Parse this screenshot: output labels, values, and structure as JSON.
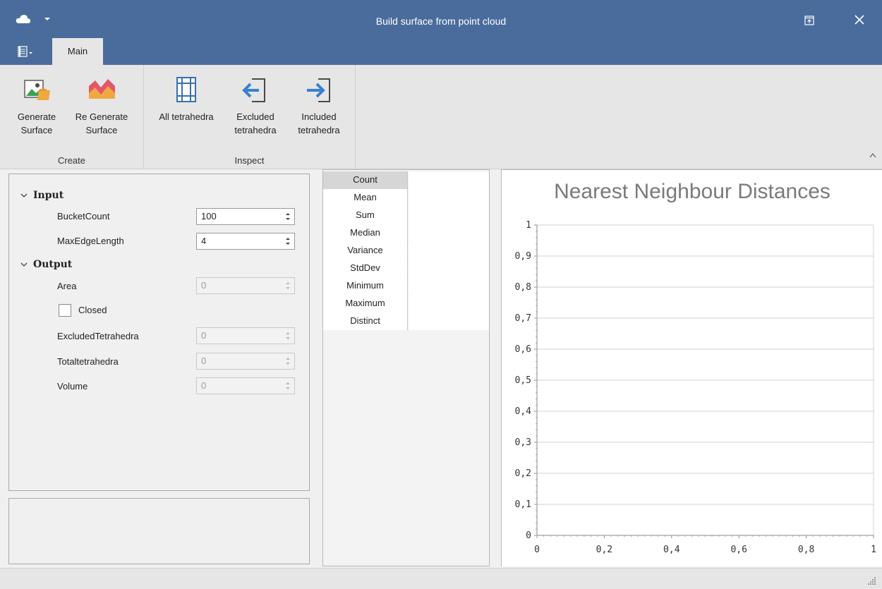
{
  "window": {
    "title": "Build surface from point cloud"
  },
  "tabs": [
    {
      "label": "Main"
    }
  ],
  "ribbon": {
    "groups": [
      {
        "label": "Create"
      },
      {
        "label": "Inspect"
      }
    ],
    "buttons": [
      {
        "line1": "Generate",
        "line2": "Surface",
        "icon": "generate-surface-icon"
      },
      {
        "line1": "Re Generate",
        "line2": "Surface",
        "icon": "regenerate-surface-icon"
      },
      {
        "line1": "All tetrahedra",
        "line2": "",
        "icon": "all-tetrahedra-icon"
      },
      {
        "line1": "Excluded",
        "line2": "tetrahedra",
        "icon": "excluded-tetrahedra-icon"
      },
      {
        "line1": "Included",
        "line2": "tetrahedra",
        "icon": "included-tetrahedra-icon"
      }
    ]
  },
  "properties": {
    "input": {
      "header": "Input",
      "bucket_count": {
        "label": "BucketCount",
        "value": "100"
      },
      "max_edge_length": {
        "label": "MaxEdgeLength",
        "value": "4"
      }
    },
    "output": {
      "header": "Output",
      "area": {
        "label": "Area",
        "value": "0"
      },
      "closed": {
        "label": "Closed",
        "checked": false
      },
      "excluded_tetrahedra": {
        "label": "ExcludedTetrahedra",
        "value": "0"
      },
      "total_tetrahedra": {
        "label": "Totaltetrahedra",
        "value": "0"
      },
      "volume": {
        "label": "Volume",
        "value": "0"
      }
    }
  },
  "stats": {
    "rows": [
      "Count",
      "Mean",
      "Sum",
      "Median",
      "Variance",
      "StdDev",
      "Minimum",
      "Maximum",
      "Distinct"
    ],
    "selected": "Count"
  },
  "colors": {
    "titlebar": "#4a6c9c",
    "ribbon": "#e6e6e6",
    "chart_title": "#7a7a7a",
    "gridline": "#d0d0d0"
  },
  "chart_data": {
    "type": "line",
    "title": "Nearest Neighbour Distances",
    "series": [],
    "xlim": [
      0,
      1
    ],
    "ylim": [
      0,
      1
    ],
    "x_ticks": [
      "0",
      "0,2",
      "0,4",
      "0,6",
      "0,8",
      "1"
    ],
    "y_ticks": [
      "0",
      "0,1",
      "0,2",
      "0,3",
      "0,4",
      "0,5",
      "0,6",
      "0,7",
      "0,8",
      "0,9",
      "1"
    ],
    "grid": true,
    "legend": "none"
  }
}
